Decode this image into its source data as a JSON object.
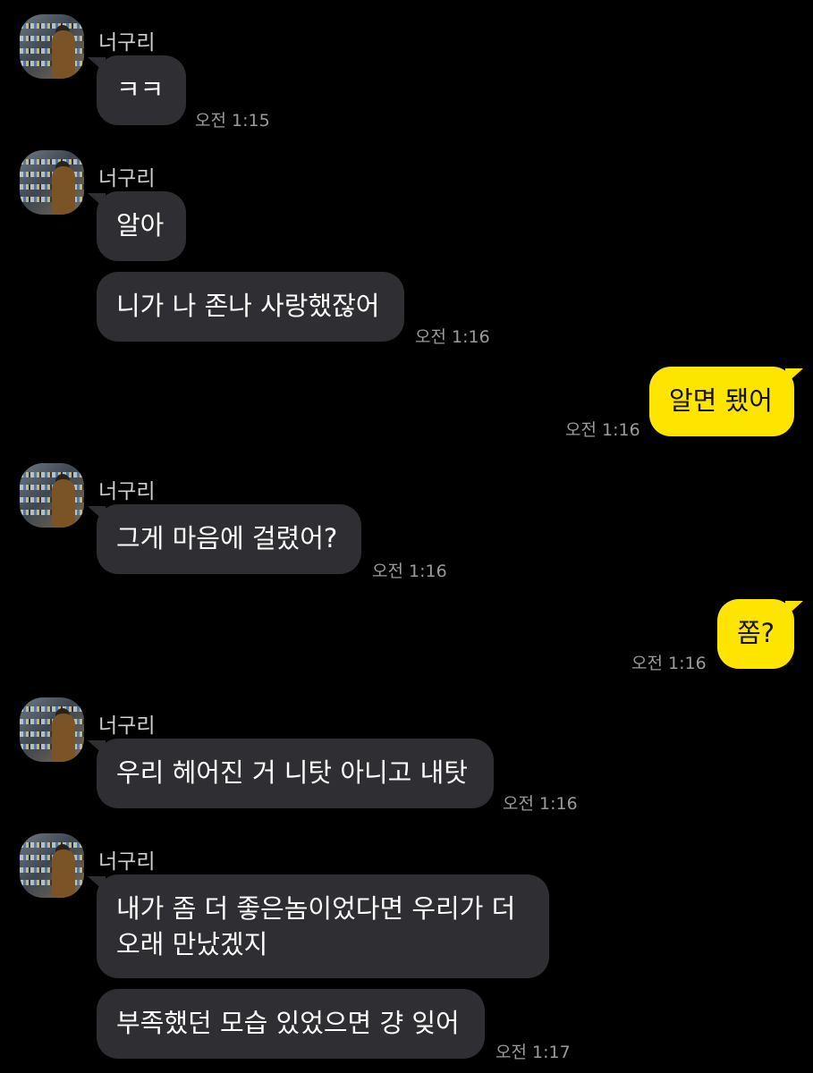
{
  "messages": [
    {
      "sender": "너구리",
      "text": "ㅋㅋ",
      "time": "오전 1:15"
    },
    {
      "sender": "너구리",
      "text": "알아"
    },
    {
      "text": "니가 나 존나 사랑했잖어",
      "time": "오전 1:16"
    },
    {
      "text": "알면 됐어",
      "time": "오전 1:16",
      "mine": true
    },
    {
      "sender": "너구리",
      "text": "그게 마음에 걸렸어?",
      "time": "오전 1:16"
    },
    {
      "text": "쫌?",
      "time": "오전 1:16",
      "mine": true
    },
    {
      "sender": "너구리",
      "text": "우리 헤어진 거 니탓 아니고 내탓",
      "time": "오전 1:16"
    },
    {
      "sender": "너구리",
      "text_line1": "내가 좀 더 좋은놈이었다면 우리가 더",
      "text_line2": "오래 만났겠지"
    },
    {
      "text": "부족했던 모습 있었으면 걍 잊어",
      "time": "오전 1:17"
    }
  ],
  "colors": {
    "background": "#000000",
    "incoming_bubble": "#2f2f33",
    "outgoing_bubble": "#fee500"
  }
}
